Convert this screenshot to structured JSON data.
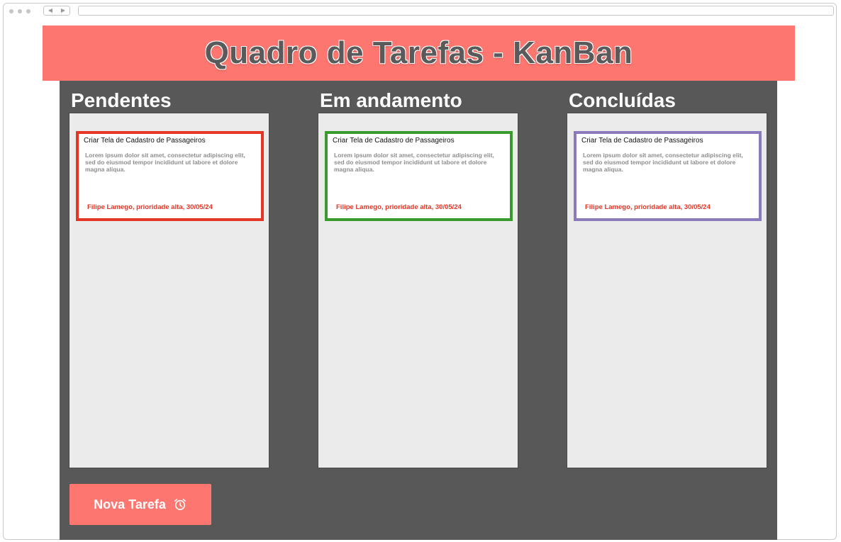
{
  "header": {
    "title": "Quadro de Tarefas - KanBan"
  },
  "columns": [
    {
      "title": "Pendentes",
      "card": {
        "title": "Criar Tela de Cadastro de Passageiros",
        "description": "Lorem ipsum dolor sit amet, consectetur adipiscing elit, sed do eiusmod tempor incididunt ut labore et dolore magna aliqua.",
        "meta": "Filipe Lamego, prioridade alta, 30/05/24",
        "border_color": "#e53524"
      }
    },
    {
      "title": "Em andamento",
      "card": {
        "title": "Criar Tela de Cadastro de Passageiros",
        "description": "Lorem ipsum dolor sit amet, consectetur adipiscing elit, sed do eiusmod tempor incididunt ut labore et dolore magna aliqua.",
        "meta": "Filipe Lamego, prioridade alta, 30/05/24",
        "border_color": "#3a9a2d"
      }
    },
    {
      "title": "Concluídas",
      "card": {
        "title": "Criar Tela de Cadastro de Passageiros",
        "description": "Lorem ipsum dolor sit amet, consectetur adipiscing elit, sed do eiusmod tempor incididunt ut labore et dolore magna aliqua.",
        "meta": "Filipe Lamego, prioridade alta, 30/05/24",
        "border_color": "#8c7bbc"
      }
    }
  ],
  "actions": {
    "new_task_label": "Nova Tarefa",
    "new_task_icon": "alarm-clock-icon"
  },
  "colors": {
    "header_bg": "#fe7670",
    "board_bg": "#585858",
    "column_bg": "#ebebeb",
    "meta_text": "#e53524"
  }
}
